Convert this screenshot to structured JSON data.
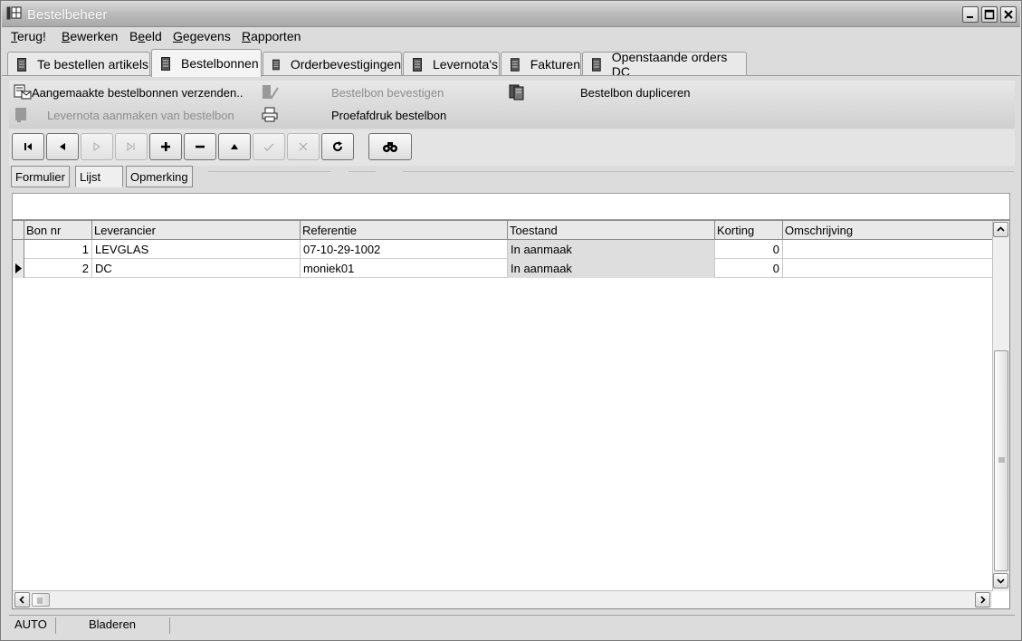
{
  "window": {
    "title": "Bestelbeheer",
    "icon": "grid-icon",
    "controls": [
      "minimize-icon",
      "maximize-icon",
      "close-icon"
    ]
  },
  "menu": [
    {
      "label": "Terug!",
      "accel": "T"
    },
    {
      "label": "Bewerken",
      "accel": "B"
    },
    {
      "label": "Beeld",
      "accel": "e"
    },
    {
      "label": "Gegevens",
      "accel": "G"
    },
    {
      "label": "Rapporten",
      "accel": "R"
    }
  ],
  "tabs": [
    {
      "label": "Te bestellen artikels"
    },
    {
      "label": "Bestelbonnen",
      "active": true
    },
    {
      "label": "Orderbevestigingen"
    },
    {
      "label": "Levernota's"
    },
    {
      "label": "Fakturen"
    },
    {
      "label": "Openstaande orders DC"
    }
  ],
  "actions": {
    "send": "Aangemaakte bestelbonnen verzenden..",
    "confirm": "Bestelbon bevestigen",
    "duplicate": "Bestelbon dupliceren",
    "delivery_note": "Levernota aanmaken van bestelbon",
    "proof_print": "Proefafdruk bestelbon"
  },
  "nav_buttons": [
    "first-icon",
    "prev-icon",
    "next-icon",
    "last-icon",
    "insert-icon",
    "delete-icon",
    "edit-icon",
    "post-icon",
    "cancel-icon",
    "refresh-icon",
    "find-icon"
  ],
  "view_tabs": {
    "form": "Formulier",
    "list": "Lijst",
    "note": "Opmerking"
  },
  "grid": {
    "columns": [
      "Bon nr",
      "Leverancier",
      "Referentie",
      "Toestand",
      "Korting",
      "Omschrijving"
    ],
    "rows": [
      {
        "bon_nr": "1",
        "leverancier": "LEVGLAS",
        "referentie": "07-10-29-1002",
        "toestand": "In aanmaak",
        "korting": "0",
        "omschrijving": ""
      },
      {
        "bon_nr": "2",
        "leverancier": "DC",
        "referentie": "moniek01",
        "toestand": "In aanmaak",
        "korting": "0",
        "omschrijving": ""
      }
    ],
    "current_row": 2
  },
  "status": {
    "mode": "AUTO",
    "state": "Bladeren"
  }
}
